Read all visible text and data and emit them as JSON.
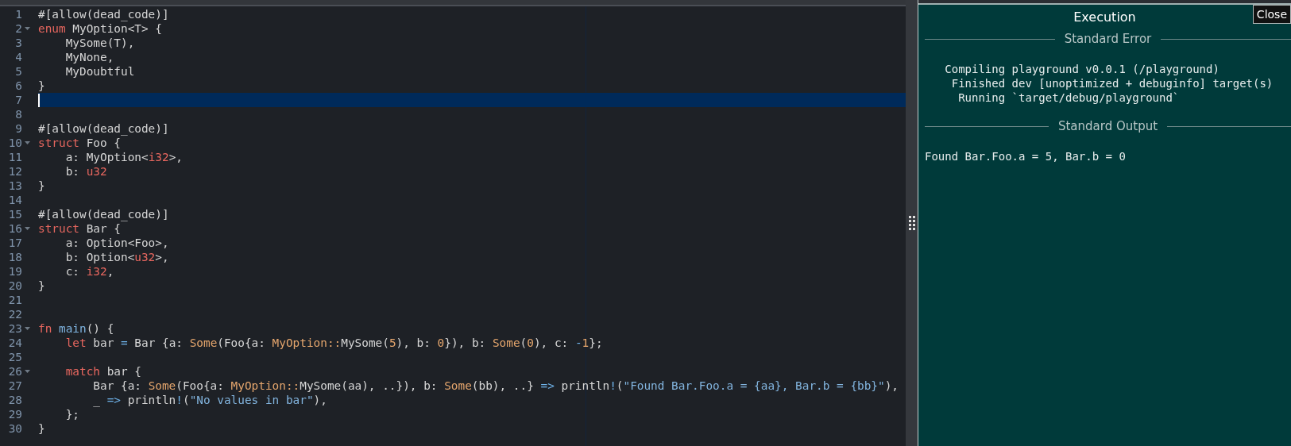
{
  "editor": {
    "lines": [
      {
        "number": "1",
        "foldable": false,
        "current": false,
        "tokens": [
          {
            "kind": "plain",
            "text": "#[allow(dead_code)]"
          }
        ]
      },
      {
        "number": "2",
        "foldable": true,
        "current": false,
        "tokens": [
          {
            "kind": "kw",
            "text": "enum"
          },
          {
            "kind": "plain",
            "text": " MyOption<T> {"
          }
        ]
      },
      {
        "number": "3",
        "foldable": false,
        "current": false,
        "tokens": [
          {
            "kind": "plain",
            "text": "    MySome(T),"
          }
        ]
      },
      {
        "number": "4",
        "foldable": false,
        "current": false,
        "tokens": [
          {
            "kind": "plain",
            "text": "    MyNone,"
          }
        ]
      },
      {
        "number": "5",
        "foldable": false,
        "current": false,
        "tokens": [
          {
            "kind": "plain",
            "text": "    MyDoubtful"
          }
        ]
      },
      {
        "number": "6",
        "foldable": false,
        "current": false,
        "tokens": [
          {
            "kind": "plain",
            "text": "}"
          }
        ]
      },
      {
        "number": "7",
        "foldable": false,
        "current": true
      },
      {
        "number": "8",
        "foldable": false,
        "current": false
      },
      {
        "number": "9",
        "foldable": false,
        "current": false,
        "tokens": [
          {
            "kind": "plain",
            "text": "#[allow(dead_code)]"
          }
        ]
      },
      {
        "number": "10",
        "foldable": true,
        "current": false,
        "tokens": [
          {
            "kind": "kw",
            "text": "struct"
          },
          {
            "kind": "plain",
            "text": " Foo {"
          }
        ]
      },
      {
        "number": "11",
        "foldable": false,
        "current": false,
        "tokens": [
          {
            "kind": "plain",
            "text": "    a: MyOption<"
          },
          {
            "kind": "type",
            "text": "i32"
          },
          {
            "kind": "plain",
            "text": ">,"
          }
        ]
      },
      {
        "number": "12",
        "foldable": false,
        "current": false,
        "tokens": [
          {
            "kind": "plain",
            "text": "    b: "
          },
          {
            "kind": "type",
            "text": "u32"
          }
        ]
      },
      {
        "number": "13",
        "foldable": false,
        "current": false,
        "tokens": [
          {
            "kind": "plain",
            "text": "}"
          }
        ]
      },
      {
        "number": "14",
        "foldable": false,
        "current": false
      },
      {
        "number": "15",
        "foldable": false,
        "current": false,
        "tokens": [
          {
            "kind": "plain",
            "text": "#[allow(dead_code)]"
          }
        ]
      },
      {
        "number": "16",
        "foldable": true,
        "current": false,
        "tokens": [
          {
            "kind": "kw",
            "text": "struct"
          },
          {
            "kind": "plain",
            "text": " Bar {"
          }
        ]
      },
      {
        "number": "17",
        "foldable": false,
        "current": false,
        "tokens": [
          {
            "kind": "plain",
            "text": "    a: Option<Foo>,"
          }
        ]
      },
      {
        "number": "18",
        "foldable": false,
        "current": false,
        "tokens": [
          {
            "kind": "plain",
            "text": "    b: Option<"
          },
          {
            "kind": "type",
            "text": "u32"
          },
          {
            "kind": "plain",
            "text": ">,"
          }
        ]
      },
      {
        "number": "19",
        "foldable": false,
        "current": false,
        "tokens": [
          {
            "kind": "plain",
            "text": "    c: "
          },
          {
            "kind": "type",
            "text": "i32"
          },
          {
            "kind": "plain",
            "text": ","
          }
        ]
      },
      {
        "number": "20",
        "foldable": false,
        "current": false,
        "tokens": [
          {
            "kind": "plain",
            "text": "}"
          }
        ]
      },
      {
        "number": "21",
        "foldable": false,
        "current": false
      },
      {
        "number": "22",
        "foldable": false,
        "current": false
      },
      {
        "number": "23",
        "foldable": true,
        "current": false,
        "tokens": [
          {
            "kind": "kw",
            "text": "fn"
          },
          {
            "kind": "fn",
            "text": " main"
          },
          {
            "kind": "plain",
            "text": "() {"
          }
        ]
      },
      {
        "number": "24",
        "foldable": false,
        "current": false,
        "tokens": [
          {
            "kind": "kw",
            "text": "    let"
          },
          {
            "kind": "plain",
            "text": " bar "
          },
          {
            "kind": "op",
            "text": "="
          },
          {
            "kind": "plain",
            "text": " Bar {a: "
          },
          {
            "kind": "call",
            "text": "Some"
          },
          {
            "kind": "plain",
            "text": "(Foo{a: "
          },
          {
            "kind": "call",
            "text": "MyOption::"
          },
          {
            "kind": "plain",
            "text": "MySome("
          },
          {
            "kind": "num",
            "text": "5"
          },
          {
            "kind": "plain",
            "text": "), b: "
          },
          {
            "kind": "num",
            "text": "0"
          },
          {
            "kind": "plain",
            "text": "}), b: "
          },
          {
            "kind": "call",
            "text": "Some"
          },
          {
            "kind": "plain",
            "text": "("
          },
          {
            "kind": "num",
            "text": "0"
          },
          {
            "kind": "plain",
            "text": "), c: "
          },
          {
            "kind": "op",
            "text": "-"
          },
          {
            "kind": "num",
            "text": "1"
          },
          {
            "kind": "plain",
            "text": "};"
          }
        ]
      },
      {
        "number": "25",
        "foldable": false,
        "current": false
      },
      {
        "number": "26",
        "foldable": true,
        "current": false,
        "tokens": [
          {
            "kind": "kw",
            "text": "    match"
          },
          {
            "kind": "plain",
            "text": " bar {"
          }
        ]
      },
      {
        "number": "27",
        "foldable": false,
        "current": false,
        "tokens": [
          {
            "kind": "plain",
            "text": "        Bar {a: "
          },
          {
            "kind": "call",
            "text": "Some"
          },
          {
            "kind": "plain",
            "text": "(Foo{a: "
          },
          {
            "kind": "call",
            "text": "MyOption::"
          },
          {
            "kind": "plain",
            "text": "MySome(aa), ..}), b: "
          },
          {
            "kind": "call",
            "text": "Some"
          },
          {
            "kind": "plain",
            "text": "(bb), ..} "
          },
          {
            "kind": "op",
            "text": "=>"
          },
          {
            "kind": "plain",
            "text": " println"
          },
          {
            "kind": "op",
            "text": "!"
          },
          {
            "kind": "plain",
            "text": "("
          },
          {
            "kind": "str",
            "text": "\"Found Bar.Foo.a = {aa}, Bar.b = {bb}\""
          },
          {
            "kind": "plain",
            "text": "),"
          }
        ]
      },
      {
        "number": "28",
        "foldable": false,
        "current": false,
        "tokens": [
          {
            "kind": "plain",
            "text": "        _ "
          },
          {
            "kind": "op",
            "text": "=>"
          },
          {
            "kind": "plain",
            "text": " println"
          },
          {
            "kind": "op",
            "text": "!"
          },
          {
            "kind": "plain",
            "text": "("
          },
          {
            "kind": "str",
            "text": "\"No values in bar\""
          },
          {
            "kind": "plain",
            "text": "),"
          }
        ]
      },
      {
        "number": "29",
        "foldable": false,
        "current": false,
        "tokens": [
          {
            "kind": "plain",
            "text": "    };"
          }
        ]
      },
      {
        "number": "30",
        "foldable": false,
        "current": false,
        "tokens": [
          {
            "kind": "plain",
            "text": "}"
          }
        ]
      }
    ]
  },
  "output": {
    "title": "Execution",
    "close_button": "Close",
    "sections": [
      {
        "heading": "Standard Error",
        "lines": [
          "   Compiling playground v0.0.1 (/playground)",
          "    Finished dev [unoptimized + debuginfo] target(s)",
          "     Running `target/debug/playground`"
        ]
      },
      {
        "heading": "Standard Output",
        "lines": [
          "Found Bar.Foo.a = 5, Bar.b = 0"
        ]
      }
    ]
  }
}
